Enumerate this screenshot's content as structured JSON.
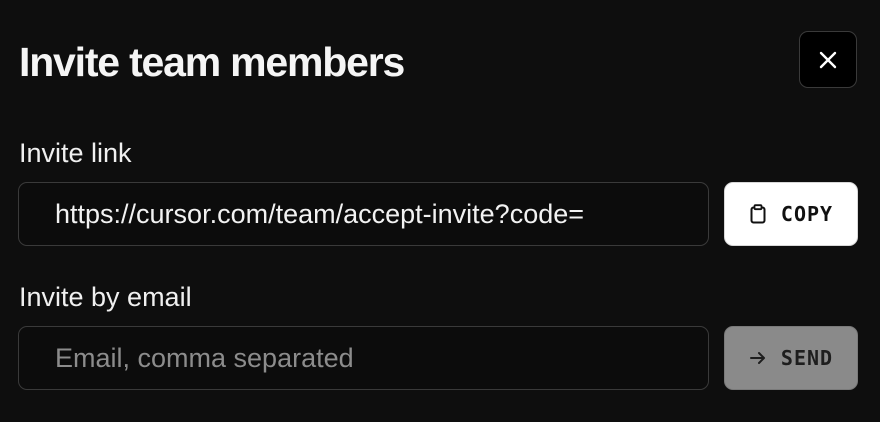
{
  "dialog": {
    "title": "Invite team members",
    "close_icon": "close-icon"
  },
  "invite_link": {
    "label": "Invite link",
    "value": "https://cursor.com/team/accept-invite?code=",
    "copy_label": "COPY",
    "copy_icon": "clipboard-icon"
  },
  "invite_email": {
    "label": "Invite by email",
    "placeholder": "Email, comma separated",
    "send_label": "SEND",
    "send_icon": "arrow-right-icon"
  },
  "colors": {
    "background": "#0e0e0e",
    "copy_button": "#ffffff",
    "send_button_disabled": "#8a8a8a"
  }
}
